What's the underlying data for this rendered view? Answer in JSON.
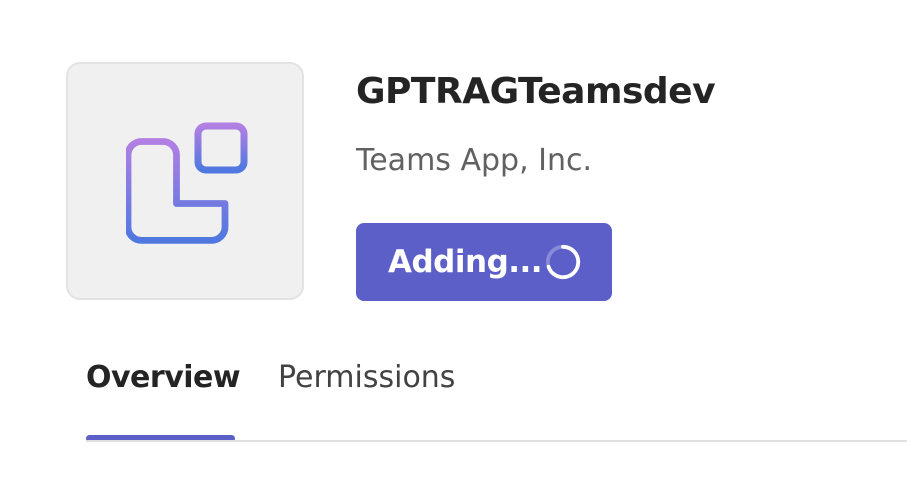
{
  "app": {
    "name": "GPTRAGTeamsdev",
    "publisher": "Teams App, Inc.",
    "icon": "apps-grid-icon"
  },
  "actions": {
    "add_button_label": "Adding...",
    "add_button_state": "loading",
    "spinner_icon": "loading-spinner-icon"
  },
  "tabs": [
    {
      "label": "Overview",
      "selected": true
    },
    {
      "label": "Permissions",
      "selected": false
    }
  ],
  "colors": {
    "accent": "#5b5fc7",
    "icon_gradient_top": "#b27fe3",
    "icon_gradient_bottom": "#4f78e0",
    "tile_background": "#f0f0f0"
  }
}
